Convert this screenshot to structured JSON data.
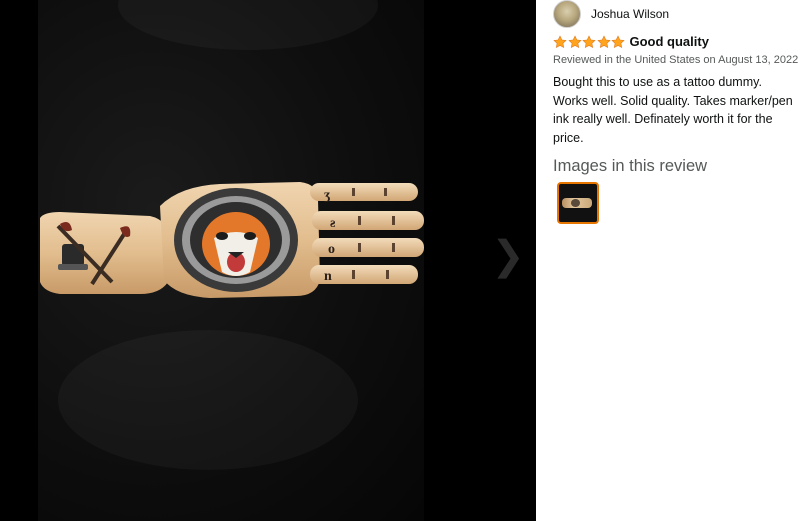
{
  "reviewer": {
    "name": "Joshua Wilson"
  },
  "review": {
    "rating": 5,
    "rating_max": 5,
    "title": "Good quality",
    "meta": "Reviewed in the United States on August 13, 2022",
    "body": "Bought this to use as a tattoo dummy. Works well. Solid quality. Takes marker/pen ink really well. Definately worth it for the price."
  },
  "images_section": {
    "heading": "Images in this review",
    "thumbnail_count": 1,
    "selected_index": 0
  },
  "viewer": {
    "next_icon": "chevron-right-icon"
  },
  "colors": {
    "star": "#ffa41c",
    "selected_border": "#e77600",
    "viewer_bg": "#000000",
    "muted_text": "#565959"
  }
}
